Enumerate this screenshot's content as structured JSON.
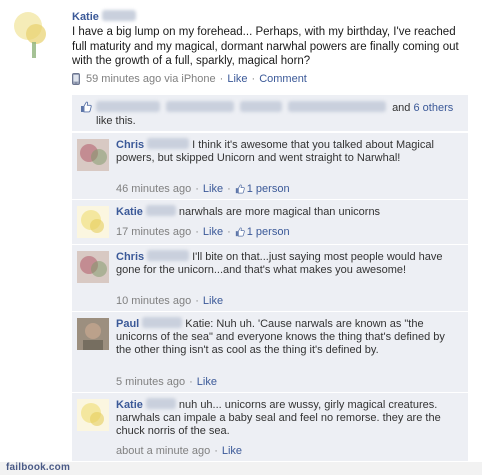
{
  "post": {
    "author_name": "Katie",
    "text": "I have a big lump on my forehead... Perhaps, with my birthday, I've reached full maturity and my magical, dormant narwhal powers are finally coming out with the growth of a full, sparkly, magical horn?",
    "time": "59 minutes ago via iPhone",
    "like_link": "Like",
    "comment_link": "Comment",
    "separator": "·"
  },
  "likes": {
    "and_text": "and",
    "others_link": "6 others",
    "suffix": "like this."
  },
  "comments": [
    {
      "author": "Chris",
      "text": "I think it's awesome that you talked about Magical powers, but skipped Unicorn and went straight to Narwhal!",
      "time": "46 minutes ago",
      "like_link": "Like",
      "likes_count": "1 person"
    },
    {
      "author": "Katie",
      "text": "narwhals are more magical than unicorns",
      "time": "17 minutes ago",
      "like_link": "Like",
      "likes_count": "1 person"
    },
    {
      "author": "Chris",
      "text": "I'll bite on that...just saying most people would have gone for the unicorn...and that's what makes you awesome!",
      "time": "10 minutes ago",
      "like_link": "Like",
      "likes_count": ""
    },
    {
      "author": "Paul",
      "text": "Katie: Nuh uh. 'Cause narwals are known as \"the unicorns of the sea\" and everyone knows the thing that's defined by the other thing isn't as cool as the thing it's defined by.",
      "time": "5 minutes ago",
      "like_link": "Like",
      "likes_count": ""
    },
    {
      "author": "Katie",
      "text": "nuh uh... unicorns are wussy, girly magical creatures. narwhals can impale a baby seal and feel no remorse. they are the chuck norris of the sea.",
      "time": "about a minute ago",
      "like_link": "Like",
      "likes_count": ""
    }
  ],
  "footer": {
    "watermark": "failbook.com"
  },
  "colors": {
    "link": "#3b5998",
    "comment_bg": "#edeff4",
    "meta_gray": "#808080"
  },
  "icons": {
    "phone": "iphone-icon",
    "thumb": "thumbs-up-icon"
  }
}
